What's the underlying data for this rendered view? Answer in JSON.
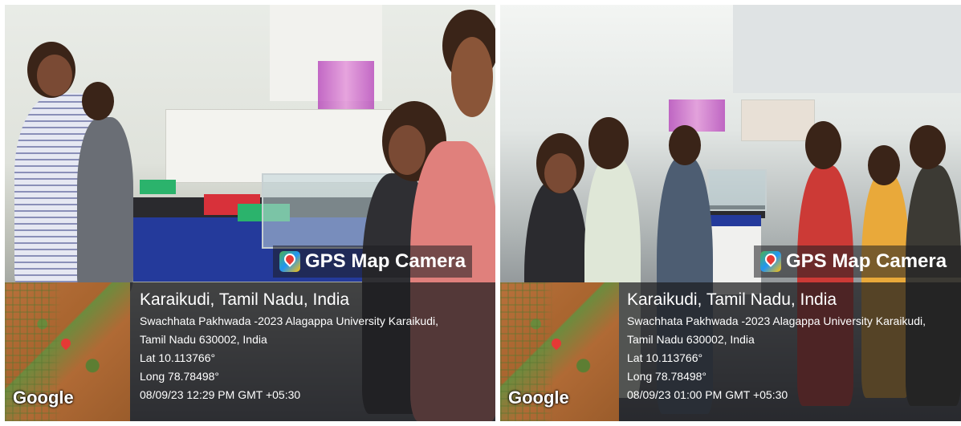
{
  "photos": [
    {
      "banner": {
        "app_name": "GPS Map Camera",
        "icon": "gps-map-camera-icon"
      },
      "map": {
        "logo": "Google",
        "pin_icon": "location-pin-icon"
      },
      "location_title": "Karaikudi, Tamil Nadu, India",
      "address_line_1": "Swachhata Pakhwada -2023 Alagappa University Karaikudi,",
      "address_line_2": "Tamil Nadu 630002, India",
      "lat": "Lat 10.113766°",
      "long": "Long 78.78498°",
      "timestamp": "08/09/23 12:29 PM GMT +05:30"
    },
    {
      "banner": {
        "app_name": "GPS Map Camera",
        "icon": "gps-map-camera-icon"
      },
      "map": {
        "logo": "Google",
        "pin_icon": "location-pin-icon"
      },
      "location_title": "Karaikudi, Tamil Nadu, India",
      "address_line_1": "Swachhata Pakhwada -2023 Alagappa University Karaikudi,",
      "address_line_2": "Tamil Nadu 630002, India",
      "lat": "Lat 10.113766°",
      "long": "Long 78.78498°",
      "timestamp": "08/09/23 01:00 PM GMT +05:30"
    }
  ]
}
